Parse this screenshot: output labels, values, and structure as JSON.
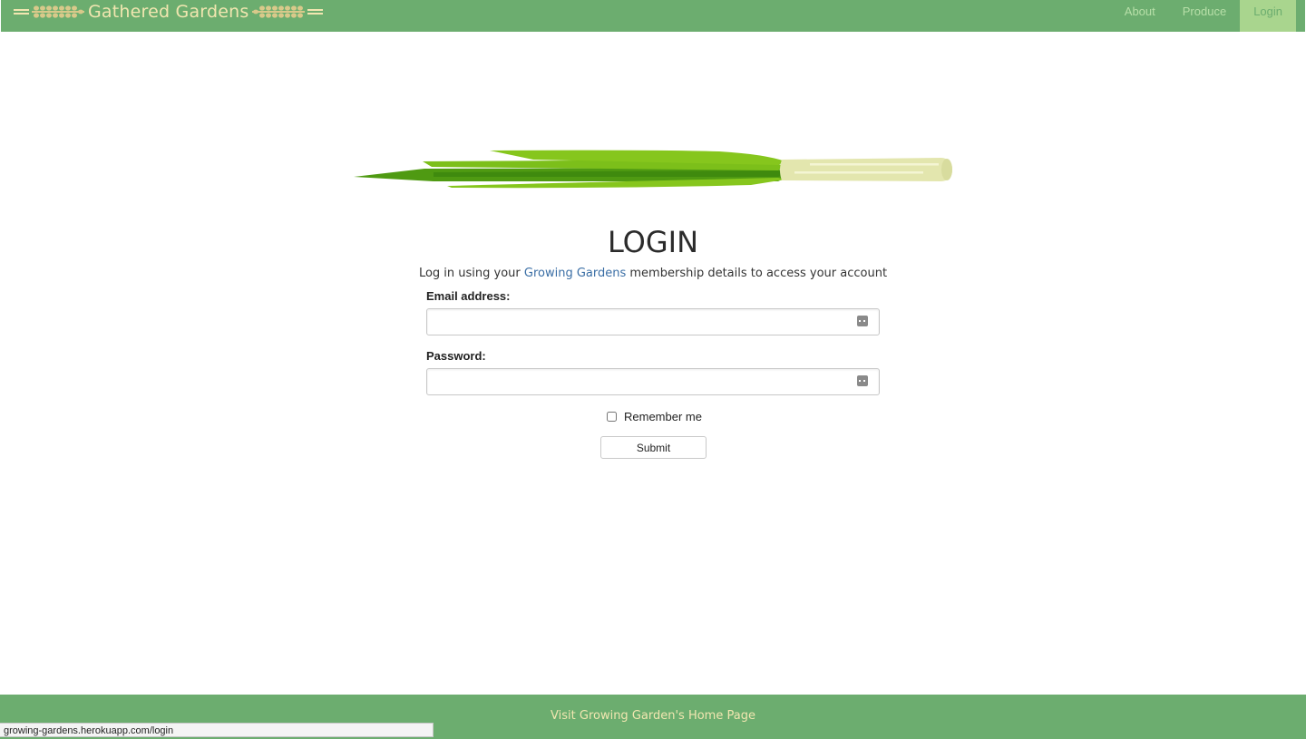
{
  "navbar": {
    "brand": "Gathered Gardens",
    "links": [
      {
        "label": "About",
        "active": false
      },
      {
        "label": "Produce",
        "active": false
      },
      {
        "label": "Login",
        "active": true
      }
    ]
  },
  "main": {
    "hero_image": "green-onion-illustration",
    "title": "LOGIN",
    "subtitle_before": "Log in using your ",
    "subtitle_link": "Growing Gardens",
    "subtitle_after": " membership details to access your account",
    "form": {
      "email_label": "Email address:",
      "email_value": "",
      "password_label": "Password:",
      "password_value": "",
      "remember_label": "Remember me",
      "remember_checked": false,
      "submit_label": "Submit"
    }
  },
  "footer": {
    "link_text": "Visit Growing Garden's Home Page"
  },
  "status_bar": {
    "url": "growing-gardens.herokuapp.com/login"
  },
  "colors": {
    "brand_green": "#6cad6f",
    "brand_cream": "#f1e6b0",
    "link_blue": "#3a6ea5",
    "active_tab": "#a9d58e"
  }
}
